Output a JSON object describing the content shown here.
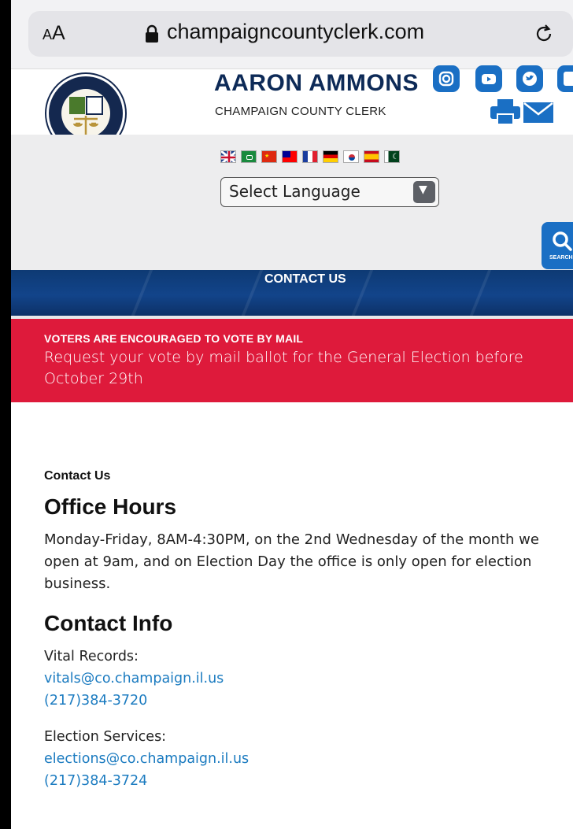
{
  "browser": {
    "text_size_label": "AA",
    "url": "champaigncountyclerk.com"
  },
  "header": {
    "name": "AARON AMMONS",
    "title": "CHAMPAIGN COUNTY CLERK",
    "seal_text": "SEAL OF THE COUNTY OF CHAMPAIGN, ILLINOIS · FEBRUARY 20, 1833",
    "social_icons": [
      "instagram-icon",
      "youtube-icon",
      "twitter-icon",
      "facebook-icon"
    ],
    "utility_icons": [
      "print-icon",
      "email-icon"
    ]
  },
  "language": {
    "flags": [
      "uk",
      "saudi-arabia",
      "china",
      "taiwan",
      "france",
      "germany",
      "south-korea",
      "spain",
      "pakistan"
    ],
    "select_label": "Select Language"
  },
  "search": {
    "label": "SEARCH"
  },
  "nav": {
    "label": "CONTACT US"
  },
  "alert": {
    "title": "VOTERS ARE ENCOURAGED TO VOTE BY MAIL",
    "text": "Request your vote by mail ballot for the General Election before October 29th"
  },
  "page": {
    "breadcrumb": "Contact Us",
    "office_hours_heading": "Office Hours",
    "office_hours_text": "Monday-Friday, 8AM-4:30PM, on the 2nd Wednesday of the month we open at 9am, and on Election Day the office is only open for election business.",
    "contact_heading": "Contact Info",
    "contacts": [
      {
        "label": "Vital Records:",
        "email": "vitals@co.champaign.il.us",
        "phone": "(217)384-3720"
      },
      {
        "label": "Election Services:",
        "email": "elections@co.champaign.il.us",
        "phone": "(217)384-3724"
      }
    ]
  },
  "colors": {
    "brand_navy": "#0d2a57",
    "accent_blue": "#1a6fc4",
    "alert_red": "#de1a3b",
    "link_blue": "#1b7bc0"
  }
}
